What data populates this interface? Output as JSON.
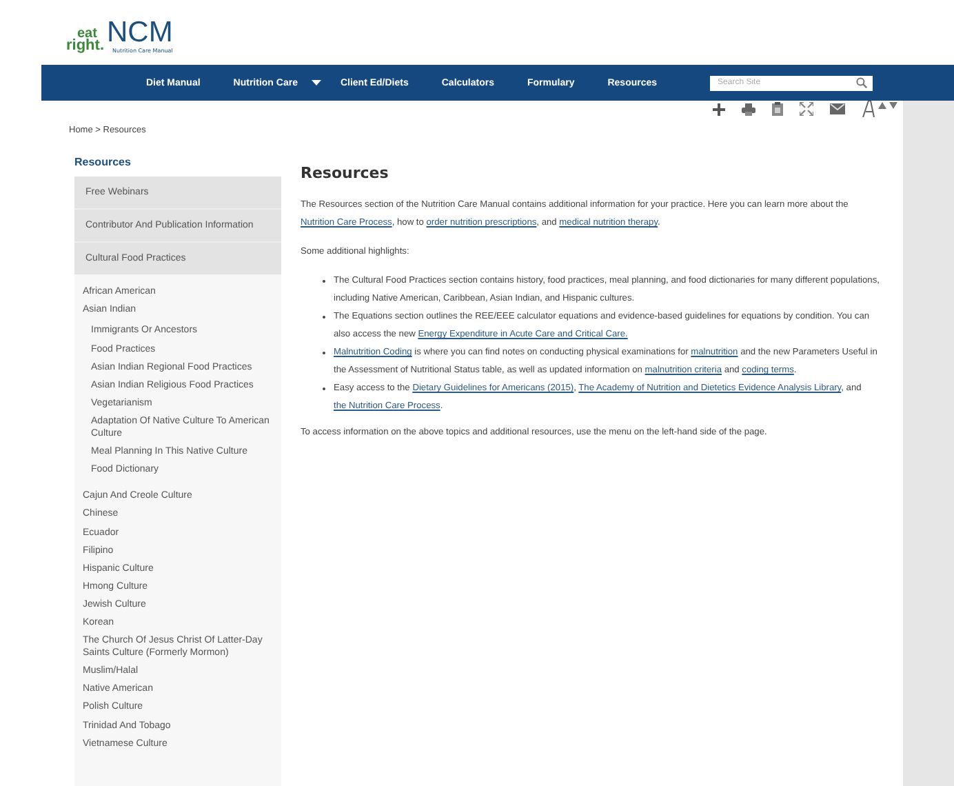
{
  "logo": {
    "top": "eat",
    "bottom": "right.",
    "name": "NCM",
    "tagline": "Nutrition Care Manual"
  },
  "nav": {
    "items": [
      {
        "label": "Diet Manual",
        "kind": "link"
      },
      {
        "label": "Nutrition Care",
        "kind": "dropdown"
      },
      {
        "label": "Client Ed/Diets",
        "kind": "link"
      },
      {
        "label": "Calculators",
        "kind": "link"
      },
      {
        "label": "Formulary",
        "kind": "link"
      },
      {
        "label": "Resources",
        "kind": "link"
      }
    ],
    "search": {
      "placeholder": "Search Site"
    }
  },
  "tools": [
    {
      "kind": "plus"
    },
    {
      "kind": "print"
    },
    {
      "kind": "clipboard"
    },
    {
      "kind": "expand"
    },
    {
      "kind": "email"
    },
    {
      "kind": "font"
    }
  ],
  "breadcrumb": "Home > Resources",
  "sidebar": {
    "title": "Resources",
    "items": [
      {
        "label": "Free Webinars"
      },
      {
        "label": "Contributor And Publication Information"
      },
      {
        "label": "Cultural Food Practices",
        "children": [
          {
            "label": "African American"
          },
          {
            "label": "Asian Indian",
            "children": [
              {
                "label": "Immigrants Or Ancestors"
              },
              {
                "label": "Food Practices"
              },
              {
                "label": "Asian Indian Regional Food Practices"
              },
              {
                "label": "Asian Indian Religious Food Practices"
              },
              {
                "label": "Vegetarianism"
              },
              {
                "label": "Adaptation Of Native Culture To American Culture"
              },
              {
                "label": "Meal Planning In This Native Culture"
              },
              {
                "label": "Food Dictionary"
              }
            ]
          },
          {
            "label": "Cajun And Creole Culture"
          },
          {
            "label": "Chinese"
          },
          {
            "label": "Ecuador"
          },
          {
            "label": "Filipino"
          },
          {
            "label": "Hispanic Culture"
          },
          {
            "label": "Hmong Culture"
          },
          {
            "label": "Jewish Culture"
          },
          {
            "label": "Korean"
          },
          {
            "label": "The Church Of Jesus Christ Of Latter-Day Saints Culture (Formerly Mormon)"
          },
          {
            "label": "Muslim/Halal"
          },
          {
            "label": "Native American"
          },
          {
            "label": "Polish Culture"
          },
          {
            "label": "Trinidad And Tobago"
          },
          {
            "label": "Vietnamese Culture"
          }
        ]
      }
    ]
  },
  "content": {
    "title": "Resources",
    "intro": [
      {
        "kind": "text",
        "text": "The Resources section of the Nutrition Care Manual contains additional information for your practice. Here you can learn more about the "
      },
      {
        "kind": "link",
        "text": "Nutrition Care Process"
      },
      {
        "kind": "text",
        "text": ", how to "
      },
      {
        "kind": "link",
        "text": "order nutrition prescriptions"
      },
      {
        "kind": "text",
        "text": ", and "
      },
      {
        "kind": "link",
        "text": "medical nutrition therapy"
      },
      {
        "kind": "text",
        "text": "."
      }
    ],
    "lead": "Some additional highlights:",
    "bullets": [
      [
        {
          "kind": "text",
          "text": "The Cultural Food Practices section contains history, food practices, meal planning, and food dictionaries for many different populations, including Native American, Caribbean, Asian Indian, and Hispanic cultures."
        }
      ],
      [
        {
          "kind": "text",
          "text": "The Equations section outlines the REE/EEE calculator equations and evidence-based guidelines for equations by condition. You can also access the new "
        },
        {
          "kind": "link",
          "text": "Energy Expenditure in Acute Care and Critical Care."
        }
      ],
      [
        {
          "kind": "link",
          "text": "Malnutrition Coding"
        },
        {
          "kind": "text",
          "text": " is where you can find notes on conducting physical examinations for "
        },
        {
          "kind": "link",
          "text": "malnutrition"
        },
        {
          "kind": "text",
          "text": " and the new Parameters Useful in the Assessment of Nutritional Status table, as well as updated information on "
        },
        {
          "kind": "link",
          "text": "malnutrition criteria"
        },
        {
          "kind": "text",
          "text": " and "
        },
        {
          "kind": "link",
          "text": "coding terms"
        },
        {
          "kind": "text",
          "text": "."
        }
      ],
      [
        {
          "kind": "text",
          "text": "Easy access to the "
        },
        {
          "kind": "link",
          "text": "Dietary Guidelines for Americans (2015)"
        },
        {
          "kind": "text",
          "text": ", "
        },
        {
          "kind": "link",
          "text": "The Academy of Nutrition and Dietetics Evidence Analysis Library"
        },
        {
          "kind": "text",
          "text": ", and "
        },
        {
          "kind": "link",
          "text": "the Nutrition Care Process"
        },
        {
          "kind": "text",
          "text": "."
        }
      ]
    ],
    "outro": "To access information on the above topics and additional resources, use the menu on the left-hand side of the page."
  }
}
